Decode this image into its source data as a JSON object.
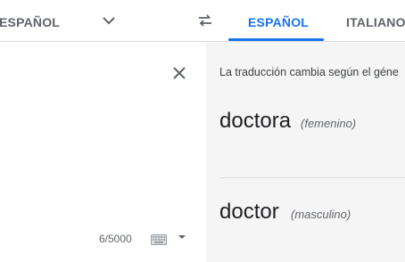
{
  "header": {
    "source_language": "ESPAÑOL",
    "target_tabs": [
      {
        "label": "ESPAÑOL",
        "active": true
      },
      {
        "label": "ITALIANO",
        "active": false
      }
    ]
  },
  "source": {
    "char_count": "6/5000"
  },
  "result": {
    "notice": "La traducción cambia según el géne",
    "translations": [
      {
        "word": "doctora",
        "gender": "(femenino)"
      },
      {
        "word": "doctor",
        "gender": "(masculino)"
      }
    ]
  },
  "colors": {
    "accent": "#1a73e8",
    "result_bg": "#f5f5f5",
    "muted_text": "#5f6368"
  },
  "icons": [
    "chevron-down-icon",
    "swap-icon",
    "close-icon",
    "keyboard-icon"
  ]
}
